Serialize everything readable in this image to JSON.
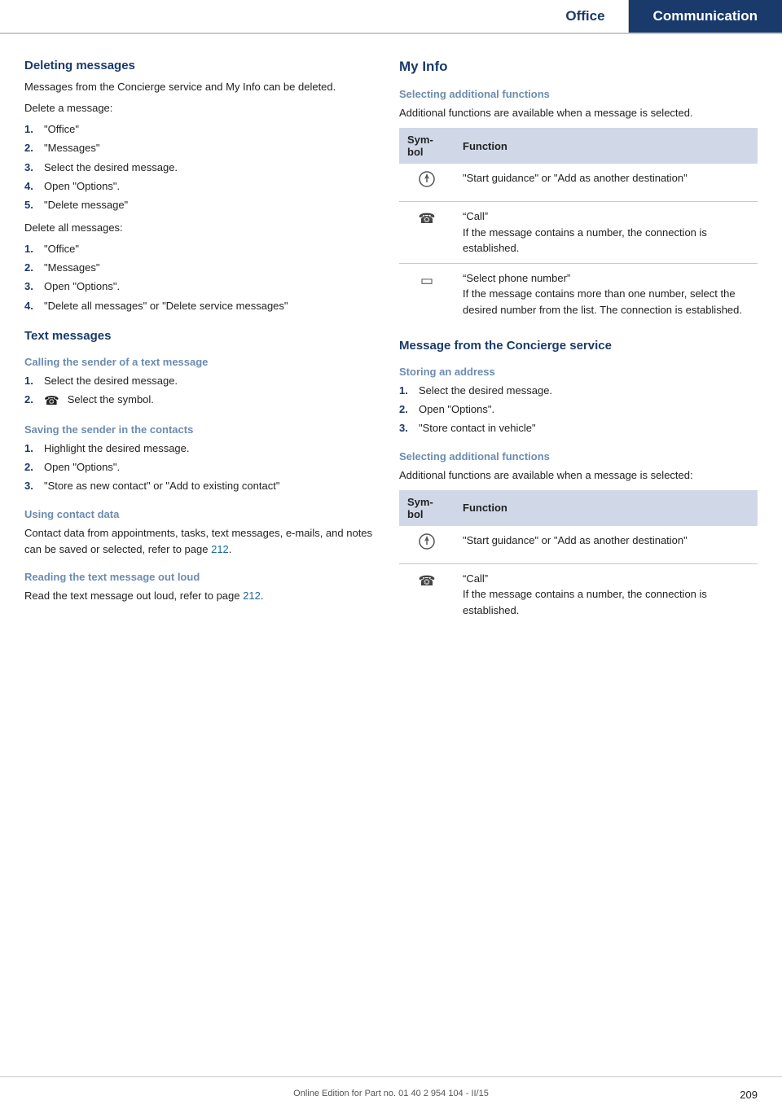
{
  "header": {
    "office_label": "Office",
    "communication_label": "Communication"
  },
  "left": {
    "deleting_messages": {
      "title": "Deleting messages",
      "intro": "Messages from the Concierge service and My Info can be deleted.",
      "delete_one_label": "Delete a message:",
      "delete_one_steps": [
        {
          "num": "1.",
          "text": "\"Office\""
        },
        {
          "num": "2.",
          "text": "\"Messages\""
        },
        {
          "num": "3.",
          "text": "Select the desired message."
        },
        {
          "num": "4.",
          "text": "Open \"Options\"."
        },
        {
          "num": "5.",
          "text": "\"Delete message\""
        }
      ],
      "delete_all_label": "Delete all messages:",
      "delete_all_steps": [
        {
          "num": "1.",
          "text": "\"Office\""
        },
        {
          "num": "2.",
          "text": "\"Messages\""
        },
        {
          "num": "3.",
          "text": "Open \"Options\"."
        },
        {
          "num": "4.",
          "text": "\"Delete all messages\" or \"Delete service messages\""
        }
      ]
    },
    "text_messages": {
      "title": "Text messages",
      "calling_title": "Calling the sender of a text message",
      "calling_steps": [
        {
          "num": "1.",
          "text": "Select the desired message."
        },
        {
          "num": "2.",
          "sym": true,
          "text": "Select the symbol."
        }
      ],
      "saving_title": "Saving the sender in the contacts",
      "saving_steps": [
        {
          "num": "1.",
          "text": "Highlight the desired message."
        },
        {
          "num": "2.",
          "text": "Open \"Options\"."
        },
        {
          "num": "3.",
          "text": "\"Store as new contact\" or \"Add to existing contact\""
        }
      ],
      "using_title": "Using contact data",
      "using_text": "Contact data from appointments, tasks, text messages, e-mails, and notes can be saved or selected, refer to page ",
      "using_page": "212",
      "reading_title": "Reading the text message out loud",
      "reading_text": "Read the text message out loud, refer to page ",
      "reading_page": "212"
    }
  },
  "right": {
    "myinfo_title": "My Info",
    "selecting_additional_title": "Selecting additional functions",
    "selecting_additional_intro": "Additional functions are available when a message is selected.",
    "table1": {
      "col_sym": "Sym-\nbol",
      "col_func": "Function",
      "rows": [
        {
          "sym": "⊕",
          "sym_type": "nav",
          "func": "\"Start guidance\" or \"Add as another destination\""
        },
        {
          "sym": "☎",
          "sym_type": "phone",
          "func": "\"Call\"\nIf the message contains a number, the connection is established."
        },
        {
          "sym": "▭",
          "sym_type": "select",
          "func": "\"Select phone number\"\nIf the message contains more than one number, select the desired number from the list. The connection is established."
        }
      ]
    },
    "concierge_title": "Message from the Concierge service",
    "storing_title": "Storing an address",
    "storing_steps": [
      {
        "num": "1.",
        "text": "Select the desired message."
      },
      {
        "num": "2.",
        "text": "Open \"Options\"."
      },
      {
        "num": "3.",
        "text": "\"Store contact in vehicle\""
      }
    ],
    "selecting_additional2_title": "Selecting additional functions",
    "selecting_additional2_intro": "Additional functions are available when a message is selected:",
    "table2": {
      "col_sym": "Sym-\nbol",
      "col_func": "Function",
      "rows": [
        {
          "sym": "⊕",
          "sym_type": "nav",
          "func": "\"Start guidance\" or \"Add as another destination\""
        },
        {
          "sym": "☎",
          "sym_type": "phone",
          "func": "\"Call\"\nIf the message contains a number, the connection is established."
        }
      ]
    }
  },
  "footer": {
    "text": "Online Edition for Part no. 01 40 2 954 104 - II/15",
    "page_number": "209"
  }
}
